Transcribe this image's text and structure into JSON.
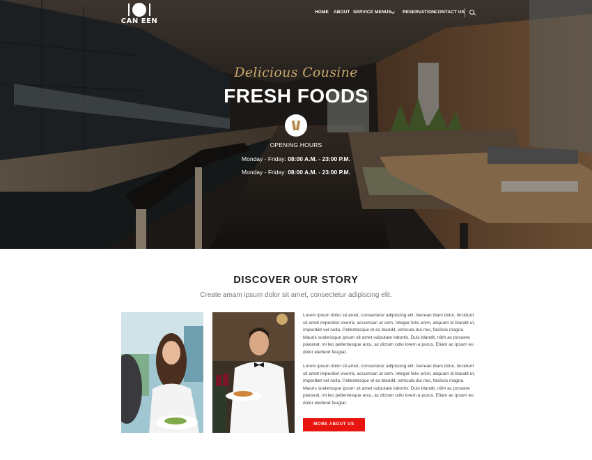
{
  "brand": {
    "logo_text": "CAN  EEN"
  },
  "nav": {
    "items": [
      {
        "label": "HOME"
      },
      {
        "label": "ABOUT"
      },
      {
        "label": "SERVICE"
      },
      {
        "label": "MENUS"
      },
      {
        "label": "RESERVATION"
      },
      {
        "label": "CONTACT US"
      }
    ],
    "search_icon": "search-icon"
  },
  "hero": {
    "script_title": "Delicious Cousine",
    "headline": "FRESH FOODS",
    "badge_icon": "wine-glasses-icon",
    "hours_title": "OPENING HOURS",
    "hours": [
      {
        "days": "Monday - Friday:",
        "time": "08:00 A.M. - 23:00 P.M."
      },
      {
        "days": "Monday - Friday:",
        "time": "08:00 A.M. - 23:00 P.M."
      }
    ]
  },
  "story": {
    "title": "DISCOVER OUR STORY",
    "subtitle": "Create amam ipsum dolor sit amet, consectetur adipiscing elit.",
    "paragraphs": [
      "Lorem ipsum dolor sit amet, consectetur adipiscing elit. Aenean diam dolor, tincidunt sit amet imperdiet viverra, accumsan at sem. Integer felis enim, aliquam id blandit ut, imperdiet vel nulla. Pellentesque et ex blandit, vehicula dui nec, facilisis magna. Mauris scelerisque ipsum sit amet vulputate lobortis. Duis blandit, nibh ac posuere placerat, mi leo pellentesque arcu, ac dictum odio lorem a purus. Etiam ac ipsum eu dolor eleifend feugiat.",
      "Lorem ipsum dolor sit amet, consectetur adipiscing elit. Aenean diam dolor, tincidunt sit amet imperdiet viverra, accumsan at sem. Integer felis enim, aliquam id blandit ut, imperdiet vel nulla. Pellentesque et ex blandit, vehicula dui nec, facilisis magna. Mauris scelerisque ipsum sit amet vulputate lobortis. Duis blandit, nibh ac posuere placerat, mi leo pellentesque arcu, ac dictum odio lorem a purus. Etiam ac ipsum eu dolor eleifend feugiat."
    ],
    "button_label": "MORE ABOUT US"
  },
  "colors": {
    "accent_red": "#e8140f",
    "script_gold": "#c9a96e",
    "heading_dark": "#1a1a1a"
  }
}
